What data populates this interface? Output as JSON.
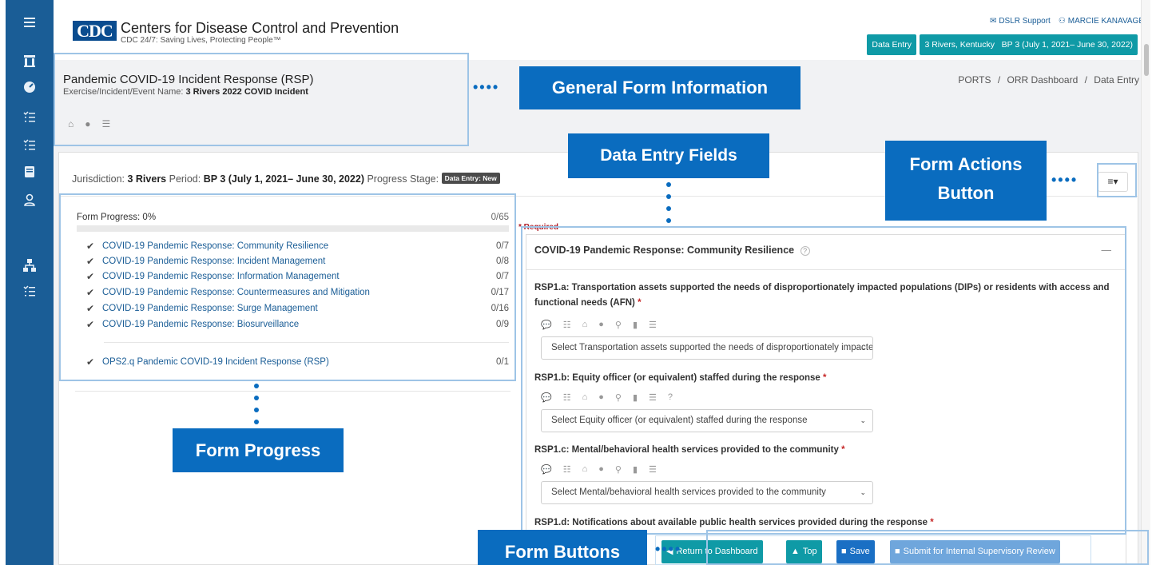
{
  "header": {
    "logo_mark": "CDC",
    "logo_title": "Centers for Disease Control and Prevention",
    "logo_tagline": "CDC 24/7: Saving Lives, Protecting People™",
    "support_link": "DSLR Support",
    "user_name": "MARCIE KANAVAGE",
    "context_pills": [
      "Data Entry",
      "3 Rivers, Kentucky",
      "BP 3 (July 1, 2021– June 30, 2022)"
    ]
  },
  "page": {
    "title": "Pandemic COVID-19 Incident Response (RSP)",
    "subtitle_label": "Exercise/Incident/Event Name: ",
    "subtitle_value": "3 Rivers 2022 COVID Incident",
    "breadcrumb": [
      "PORTS",
      "ORR Dashboard",
      "Data Entry"
    ],
    "breadcrumb_sep": "/"
  },
  "jurisdiction": {
    "label": "Jurisdiction: ",
    "value": "3 Rivers",
    "period_label": " Period: ",
    "period_value": "BP 3 (July 1, 2021– June 30, 2022)",
    "stage_label": " Progress Stage: ",
    "stage_badge": "Data Entry: New"
  },
  "actions_button": {
    "label": "≡▾"
  },
  "progress": {
    "title": "Form Progress: 0%",
    "count": "0/65",
    "fraction": 0,
    "sections": [
      {
        "label": "COVID-19 Pandemic Response: Community Resilience",
        "count": "0/7"
      },
      {
        "label": "COVID-19 Pandemic Response: Incident Management",
        "count": "0/8"
      },
      {
        "label": "COVID-19 Pandemic Response: Information Management",
        "count": "0/7"
      },
      {
        "label": "COVID-19 Pandemic Response: Countermeasures and Mitigation",
        "count": "0/17"
      },
      {
        "label": "COVID-19 Pandemic Response: Surge Management",
        "count": "0/16"
      },
      {
        "label": "COVID-19 Pandemic Response: Biosurveillance",
        "count": "0/9"
      }
    ],
    "extra_section": {
      "label": "OPS2.q Pandemic COVID-19 Incident Response (RSP)",
      "count": "0/1"
    }
  },
  "form": {
    "required_note": "* Required",
    "panel_title": "COVID-19 Pandemic Response: Community Resilience",
    "questions": [
      {
        "label": "RSP1.a: Transportation assets supported the needs of disproportionately impacted populations (DIPs) or residents with access and functional needs (AFN)",
        "select": "Select Transportation assets supported the needs of disproportionately impacted populations (DIPs) or residents with access and functional needs (AFN)"
      },
      {
        "label": "RSP1.b: Equity officer (or equivalent) staffed during the response",
        "select": "Select Equity officer (or equivalent) staffed during the response"
      },
      {
        "label": "RSP1.c: Mental/behavioral health services provided to the community",
        "select": "Select Mental/behavioral health services provided to the community"
      },
      {
        "label": "RSP1.d: Notifications about available public health services provided during the response",
        "select": ""
      }
    ]
  },
  "footer_buttons": {
    "return": "Return to Dashboard",
    "top": "Top",
    "save": "Save",
    "submit": "Submit for Internal Supervisory Review"
  },
  "annotations": {
    "general_form_info": "General Form Information",
    "data_entry_fields": "Data Entry Fields",
    "form_actions_button_l1": "Form Actions",
    "form_actions_button_l2": "Button",
    "form_progress": "Form Progress",
    "form_buttons": "Form Buttons"
  },
  "colors": {
    "sidebar": "#1a5d96",
    "teal_button": "#0f9aa6",
    "primary_button": "#1a6fc4",
    "callout": "#0a6cbf",
    "required": "#b0202a"
  }
}
